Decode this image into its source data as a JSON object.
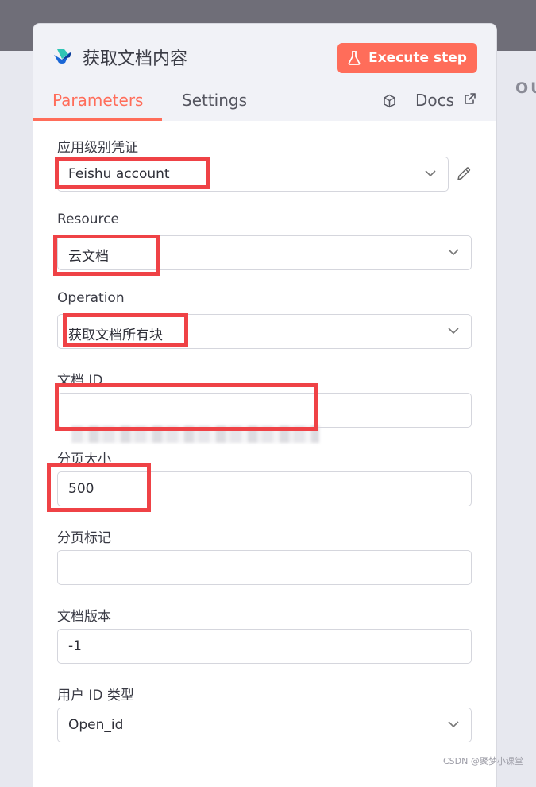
{
  "background": {
    "out_label": "OU"
  },
  "node": {
    "title": "获取文档内容",
    "execute_label": "Execute step",
    "accent_color": "#ff6d5a"
  },
  "tabs": {
    "parameters": "Parameters",
    "settings": "Settings",
    "docs": "Docs",
    "active": "Parameters"
  },
  "fields": {
    "credential": {
      "label": "应用级别凭证",
      "value": "Feishu account"
    },
    "resource": {
      "label": "Resource",
      "value": "云文档"
    },
    "operation": {
      "label": "Operation",
      "value": "获取文档所有块"
    },
    "doc_id": {
      "label": "文档 ID",
      "value": ""
    },
    "page_size": {
      "label": "分页大小",
      "value": "500"
    },
    "page_token": {
      "label": "分页标记",
      "value": ""
    },
    "doc_version": {
      "label": "文档版本",
      "value": "-1"
    },
    "user_id_type": {
      "label": "用户 ID 类型",
      "value": "Open_id"
    }
  },
  "watermark": "CSDN @聚梦小课堂",
  "highlight_color": "#ef4246"
}
